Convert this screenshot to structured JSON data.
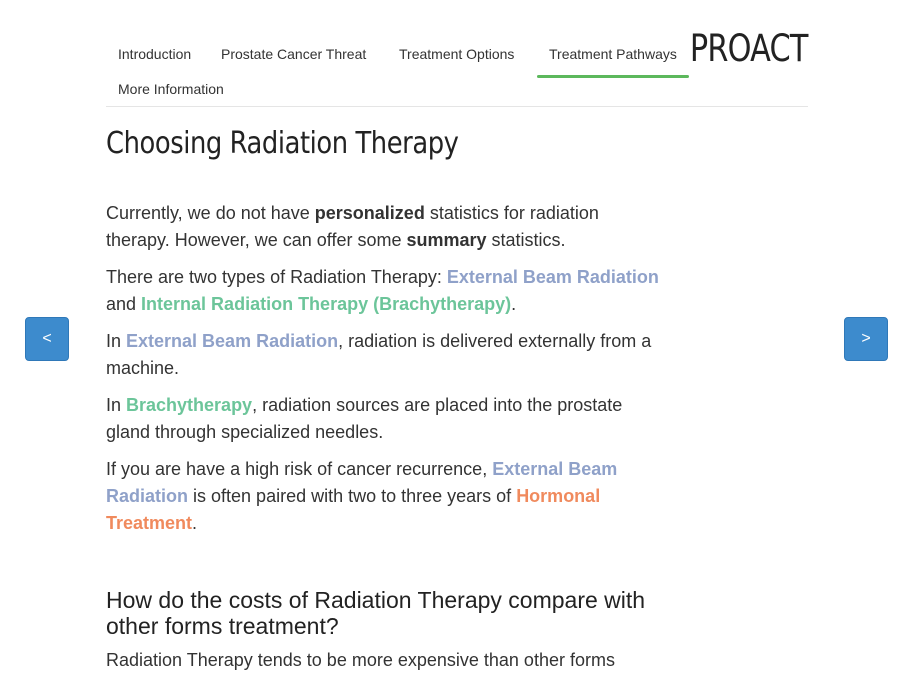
{
  "nav": {
    "items": [
      {
        "label": "Introduction"
      },
      {
        "label": "Prostate Cancer Threat"
      },
      {
        "label": "Treatment Options"
      },
      {
        "label": "Treatment Pathways"
      },
      {
        "label": "More Information"
      }
    ],
    "brand": "PROACT"
  },
  "page": {
    "title": "Choosing Radiation Therapy",
    "p1": {
      "a": "Currently, we do not have ",
      "b": "personalized",
      "c": " statistics for radiation therapy. However, we can offer some ",
      "d": "summary",
      "e": " statistics."
    },
    "p2": {
      "a": "There are two types of Radiation Therapy: ",
      "ext": "External Beam Radiation",
      "b": " and ",
      "int": "Internal Radiation Therapy (Brachytherapy)",
      "c": "."
    },
    "p3": {
      "a": "In ",
      "ext": "External Beam Radiation",
      "b": ", radiation is delivered externally from a machine."
    },
    "p4": {
      "a": "In ",
      "int": "Brachytherapy",
      "b": ", radiation sources are placed into the prostate gland through specialized needles."
    },
    "p5": {
      "a": "If you are have a high risk of cancer recurrence, ",
      "ext": "External Beam Radiation",
      "b": " is often paired with two to three years of ",
      "horm": "Hormonal Treatment",
      "c": "."
    },
    "subheading": "How do the costs of Radiation Therapy compare with other forms treatment?",
    "cut_text": "Radiation Therapy tends to be more expensive than other forms"
  },
  "arrows": {
    "prev": "<",
    "next": ">"
  }
}
